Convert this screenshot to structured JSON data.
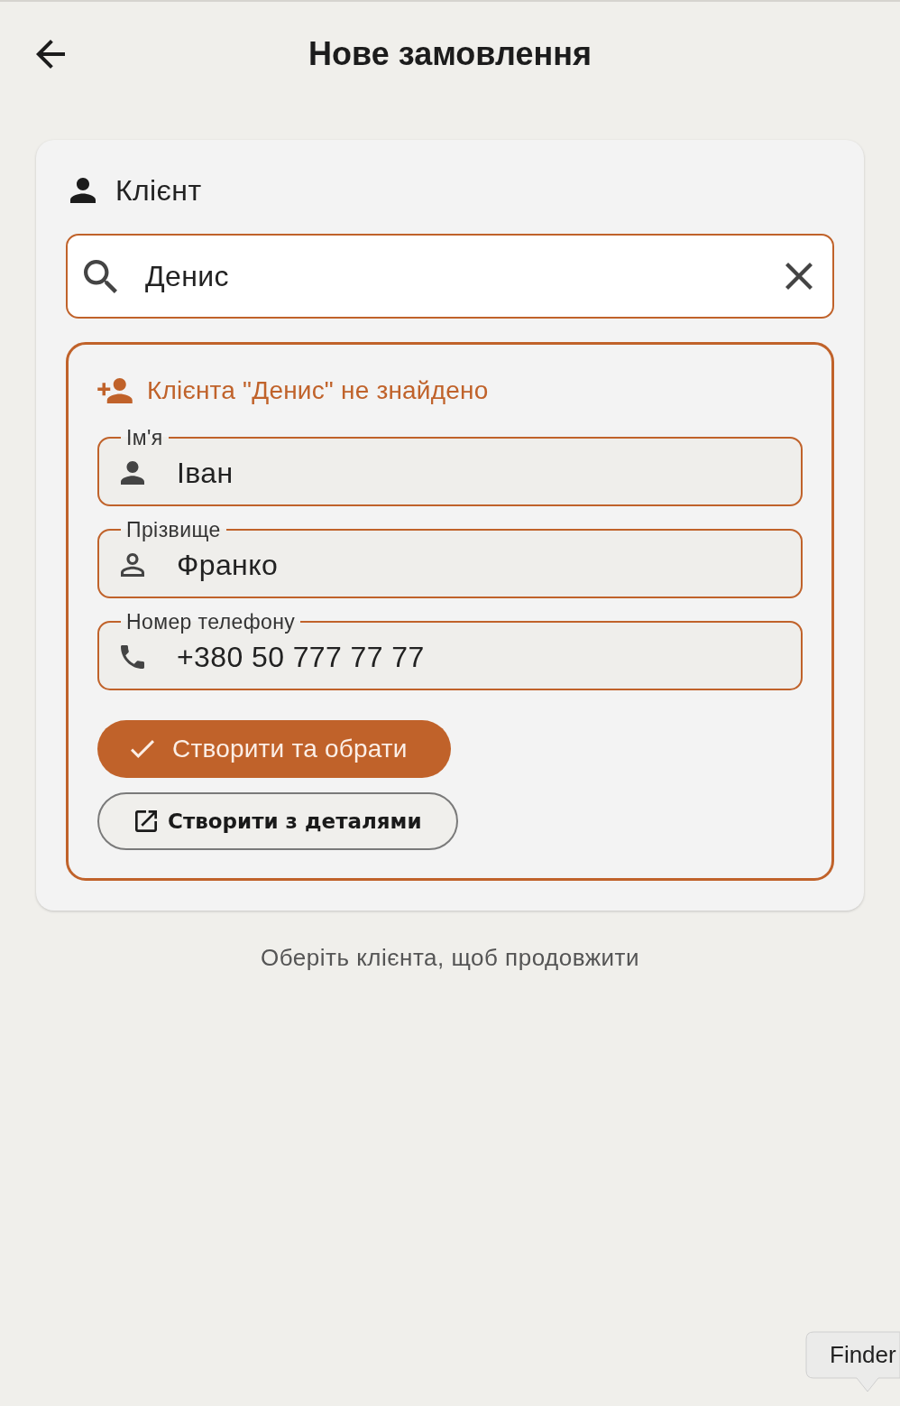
{
  "header": {
    "title": "Нове замовлення"
  },
  "client_section": {
    "title": "Клієнт",
    "search": {
      "value": "Денис"
    }
  },
  "not_found": {
    "message": "Клієнта \"Денис\" не знайдено",
    "fields": [
      {
        "kind": "person",
        "label": "Ім'я",
        "value": "Іван"
      },
      {
        "kind": "person-outline",
        "label": "Прізвище",
        "value": "Франко"
      },
      {
        "kind": "phone",
        "label": "Номер телефону",
        "value": "+380 50 777 77 77"
      }
    ],
    "buttons": [
      {
        "kind": "primary",
        "label": "Створити та обрати"
      },
      {
        "kind": "outlined",
        "label": "Створити з деталями"
      }
    ]
  },
  "hint": "Оберіть клієнта, щоб продовжити",
  "tooltip": {
    "text": "Finder"
  }
}
